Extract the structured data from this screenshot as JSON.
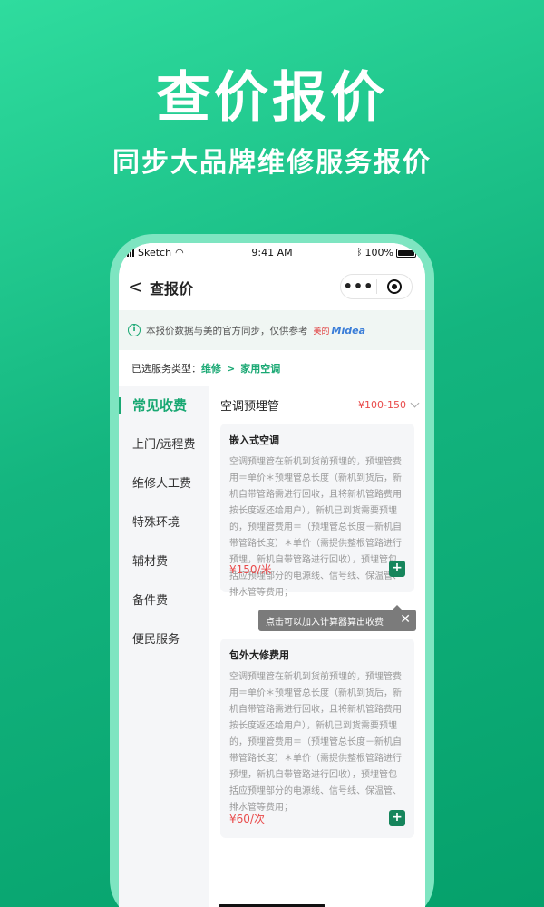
{
  "hero": {
    "title": "查价报价",
    "subtitle": "同步大品牌维修服务报价"
  },
  "statusbar": {
    "carrier": "Sketch",
    "time": "9:41 AM",
    "battery": "100%"
  },
  "navbar": {
    "back_glyph": "<",
    "title": "查报价",
    "more_glyph": "•••"
  },
  "notice": {
    "text": "本报价数据与美的官方同步，仅供参考",
    "brand_cn": "美的",
    "brand_en": "Midea"
  },
  "service_type": {
    "label": "已选服务类型：",
    "level1": "维修",
    "level2": "家用空调"
  },
  "sidebar": {
    "items": [
      {
        "label": "常见收费"
      },
      {
        "label": "上门/远程费"
      },
      {
        "label": "维修人工费"
      },
      {
        "label": "特殊环境"
      },
      {
        "label": "辅材费"
      },
      {
        "label": "备件费"
      },
      {
        "label": "便民服务"
      }
    ]
  },
  "category": {
    "name": "空调预埋管",
    "price_range": "¥100-150"
  },
  "cards": [
    {
      "title": "嵌入式空调",
      "desc": "空调预埋管在新机到货前预埋的，预埋管费用＝单价＊预埋管总长度（新机到货后，新机自带管路需进行回收，且将新机管路费用按长度返还给用户），新机已到货需要预埋的，预埋管费用＝（预埋管总长度－新机自带管路长度）＊单价（需提供整根管路进行预埋，新机自带管路进行回收），预埋管包括应预埋部分的电源线、信号线、保温管、排水管等费用；",
      "price": "¥150/米",
      "add": "+"
    },
    {
      "title": "包外大修费用",
      "desc": "空调预埋管在新机到货前预埋的，预埋管费用＝单价＊预埋管总长度（新机到货后，新机自带管路需进行回收，且将新机管路费用按长度返还给用户），新机已到货需要预埋的，预埋管费用＝（预埋管总长度－新机自带管路长度）＊单价（需提供整根管路进行预埋，新机自带管路进行回收），预埋管包括应预埋部分的电源线、信号线、保温管、排水管等费用；",
      "price": "¥60/次",
      "add": "+"
    }
  ],
  "tooltip": {
    "text": "点击可以加入计算器算出收费",
    "close": "✕"
  },
  "colors": {
    "accent": "#19a873",
    "price": "#e94b4b",
    "add_button": "#16855c"
  }
}
